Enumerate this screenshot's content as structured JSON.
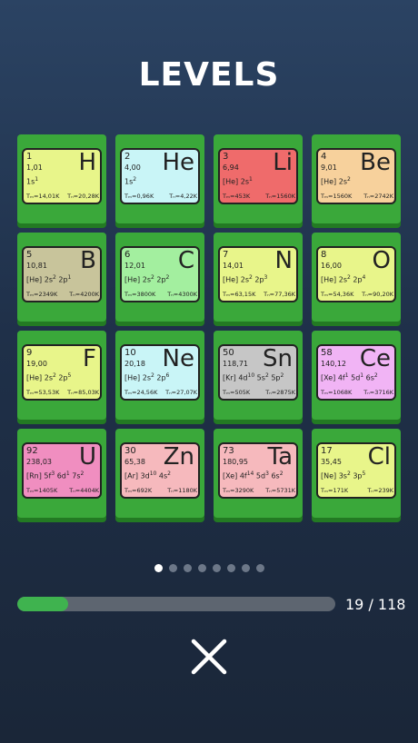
{
  "header": {
    "title": "LEVELS"
  },
  "elements": [
    {
      "num": "1",
      "mass": "1,01",
      "sym": "H",
      "conf": "1s<sup>1</sup>",
      "tm": "Tₘ=14,01K",
      "tb": "Tₙ=20,28K",
      "color": "#e8f58a"
    },
    {
      "num": "2",
      "mass": "4,00",
      "sym": "He",
      "conf": "1s<sup>2</sup>",
      "tm": "Tₘ=0,96K",
      "tb": "Tₙ=4,22K",
      "color": "#c9f5f7"
    },
    {
      "num": "3",
      "mass": "6,94",
      "sym": "Li",
      "conf": "[He] 2s<sup>1</sup>",
      "tm": "Tₘ=453K",
      "tb": "Tₙ=1560K",
      "color": "#ef6b6b"
    },
    {
      "num": "4",
      "mass": "9,01",
      "sym": "Be",
      "conf": "[He] 2s<sup>2</sup>",
      "tm": "Tₘ=1560K",
      "tb": "Tₙ=2742K",
      "color": "#f7d19c"
    },
    {
      "num": "5",
      "mass": "10,81",
      "sym": "B",
      "conf": "[He] 2s<sup>2</sup> 2p<sup>1</sup>",
      "tm": "Tₘ=2349K",
      "tb": "Tₙ=4200K",
      "color": "#c8c49b"
    },
    {
      "num": "6",
      "mass": "12,01",
      "sym": "C",
      "conf": "[He] 2s<sup>2</sup> 2p<sup>2</sup>",
      "tm": "Tₘ=3800K",
      "tb": "Tₙ=4300K",
      "color": "#a3ef9f"
    },
    {
      "num": "7",
      "mass": "14,01",
      "sym": "N",
      "conf": "[He] 2s<sup>2</sup> 2p<sup>3</sup>",
      "tm": "Tₘ=63,15K",
      "tb": "Tₙ=77,36K",
      "color": "#e8f58a"
    },
    {
      "num": "8",
      "mass": "16,00",
      "sym": "O",
      "conf": "[He] 2s<sup>2</sup> 2p<sup>4</sup>",
      "tm": "Tₘ=54,36K",
      "tb": "Tₙ=90,20K",
      "color": "#e8f58a"
    },
    {
      "num": "9",
      "mass": "19,00",
      "sym": "F",
      "conf": "[He] 2s<sup>2</sup> 2p<sup>5</sup>",
      "tm": "Tₘ=53,53K",
      "tb": "Tₙ=85,03K",
      "color": "#e8f58a"
    },
    {
      "num": "10",
      "mass": "20,18",
      "sym": "Ne",
      "conf": "[He] 2s<sup>2</sup> 2p<sup>6</sup>",
      "tm": "Tₘ=24,56K",
      "tb": "Tₙ=27,07K",
      "color": "#c9f5f7"
    },
    {
      "num": "50",
      "mass": "118,71",
      "sym": "Sn",
      "conf": "[Kr] 4d<sup>10</sup> 5s<sup>2</sup> 5p<sup>2</sup>",
      "tm": "Tₘ=505K",
      "tb": "Tₙ=2875K",
      "color": "#c6c6c6"
    },
    {
      "num": "58",
      "mass": "140,12",
      "sym": "Ce",
      "conf": "[Xe] 4f<sup>1</sup> 5d<sup>1</sup> 6s<sup>2</sup>",
      "tm": "Tₘ=1068K",
      "tb": "Tₙ=3716K",
      "color": "#f1b4f5"
    },
    {
      "num": "92",
      "mass": "238,03",
      "sym": "U",
      "conf": "[Rn] 5f<sup>3</sup> 6d<sup>1</sup> 7s<sup>2</sup>",
      "tm": "Tₘ=1405K",
      "tb": "Tₙ=4404K",
      "color": "#f08ec0"
    },
    {
      "num": "30",
      "mass": "65,38",
      "sym": "Zn",
      "conf": "[Ar] 3d<sup>10</sup> 4s<sup>2</sup>",
      "tm": "Tₘ=692K",
      "tb": "Tₙ=1180K",
      "color": "#f6b9bd"
    },
    {
      "num": "73",
      "mass": "180,95",
      "sym": "Ta",
      "conf": "[Xe] 4f<sup>14</sup> 5d<sup>3</sup> 6s<sup>2</sup>",
      "tm": "Tₘ=3290K",
      "tb": "Tₙ=5731K",
      "color": "#f6b9bd"
    },
    {
      "num": "17",
      "mass": "35,45",
      "sym": "Cl",
      "conf": "[Ne] 3s<sup>2</sup> 3p<sup>5</sup>",
      "tm": "Tₘ=171K",
      "tb": "Tₙ=239K",
      "color": "#e8f58a"
    }
  ],
  "pager": {
    "count": 8,
    "active_index": 0
  },
  "progress": {
    "value": 19,
    "max": 118,
    "label": "19 / 118"
  },
  "close": {
    "icon": "close-icon"
  }
}
